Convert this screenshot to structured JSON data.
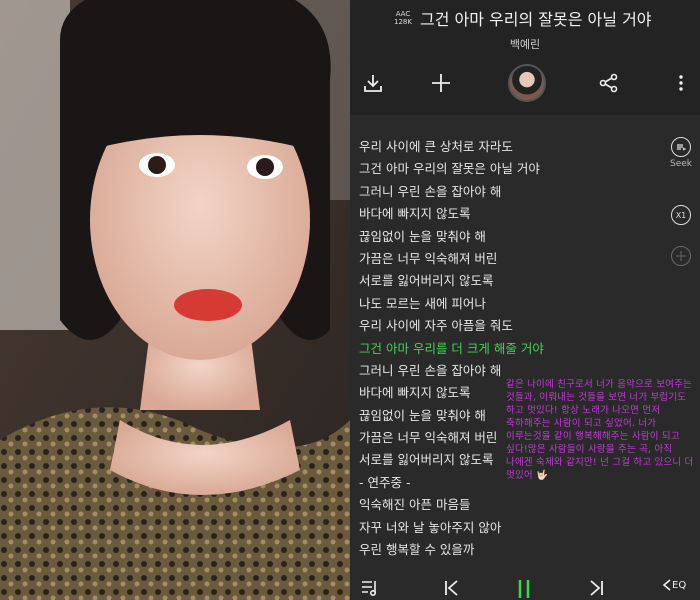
{
  "header": {
    "codec": "AAC",
    "bitrate": "128K",
    "song_title": "그건 아마 우리의 잘못은 아닐 거야",
    "artist": "백예린"
  },
  "toolbar": {
    "icons": [
      "download-icon",
      "add-icon",
      "album-avatar",
      "share-icon",
      "more-icon"
    ]
  },
  "side_controls": {
    "seek_label": "Seek",
    "speed_label": "X1"
  },
  "lyrics": [
    "우리 사이에 큰 상처로 자라도",
    "그건 아마 우리의 잘못은 아닐 거야",
    "그러니 우린 손을 잡아야 해",
    "바다에 빠지지 않도록",
    "끊임없이 눈을 맞춰야 해",
    "가끔은 너무 익숙해져 버린",
    "서로를 잃어버리지 않도록",
    "나도 모르는 새에 피어나",
    "우리 사이에 자주 아픔을 줘도",
    "그건 아마 우리를 더 크게 해줄 거야",
    "그러니 우린 손을 잡아야 해",
    "바다에 빠지지 않도록",
    "끊임없이 눈을 맞춰야 해",
    "가끔은 너무 익숙해져 버린",
    "서로를 잃어버리지 않도록",
    "- 연주중 -",
    "익숙해진 아픈 마음들",
    "자꾸 너와 날 놓아주지 않아",
    "우린 행복할 수 있을까"
  ],
  "active_lyric_index": 9,
  "message": "같은 나이에 친구로서 너가 음악으로 보여주는 것들과, 이뤄내는 것들을 보면 너가 부럽기도 하고 멋있다! 항상 노래가 나오면 먼저 축하해주는 사람이 되고 싶었어. 너가 이루는것을 같이 행복해해주는 사람이 되고 싶다!많은 사람들이 사랑을 주는 곡, 아직 나에겐 숙제와 같지만! 넌 그걸 하고 있으니 더 멋있어 🤟🏻",
  "bottom_bar": {
    "eq_label": "EQ"
  },
  "colors": {
    "active_lyric": "#3fd356",
    "message": "#c23bd6",
    "play": "#3fd356"
  }
}
